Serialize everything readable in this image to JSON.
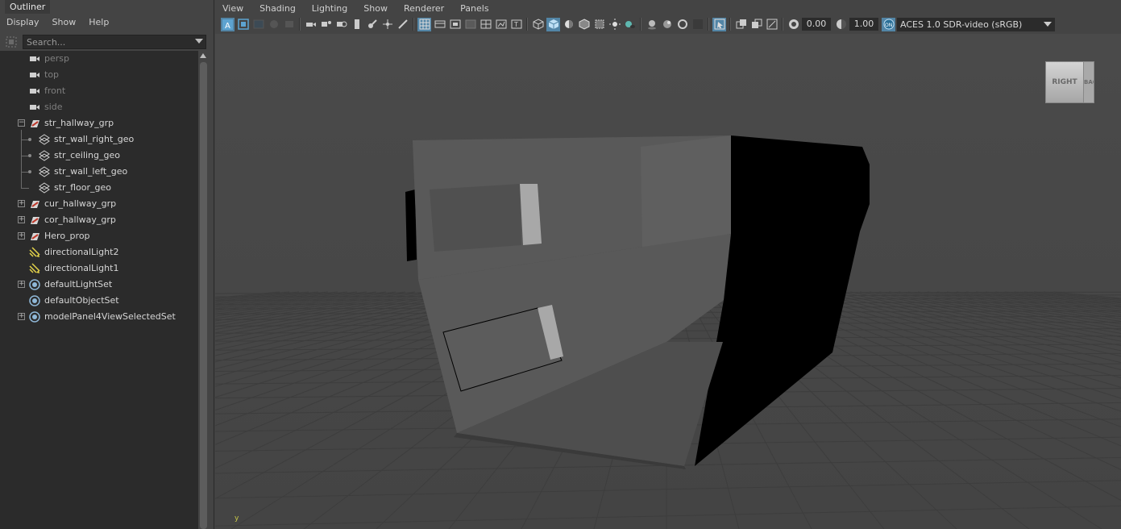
{
  "outliner": {
    "tab_title": "Outliner",
    "menu": [
      "Display",
      "Show",
      "Help"
    ],
    "search_placeholder": "Search...",
    "items": [
      {
        "label": "persp",
        "icon": "camera-icon"
      },
      {
        "label": "top",
        "icon": "camera-icon"
      },
      {
        "label": "front",
        "icon": "camera-icon"
      },
      {
        "label": "side",
        "icon": "camera-icon"
      },
      {
        "label": "str_hallway_grp",
        "icon": "group-icon",
        "expanded": true
      },
      {
        "label": "str_wall_right_geo",
        "icon": "mesh-icon"
      },
      {
        "label": "str_ceiling_geo",
        "icon": "mesh-icon"
      },
      {
        "label": "str_wall_left_geo",
        "icon": "mesh-icon"
      },
      {
        "label": "str_floor_geo",
        "icon": "mesh-icon"
      },
      {
        "label": "cur_hallway_grp",
        "icon": "group-icon",
        "expanded": false
      },
      {
        "label": "cor_hallway_grp",
        "icon": "group-icon",
        "expanded": false
      },
      {
        "label": "Hero_prop",
        "icon": "group-icon",
        "expanded": false
      },
      {
        "label": "directionalLight2",
        "icon": "directional-light-icon"
      },
      {
        "label": "directionalLight1",
        "icon": "directional-light-icon"
      },
      {
        "label": "defaultLightSet",
        "icon": "set-icon",
        "expanded": false
      },
      {
        "label": "defaultObjectSet",
        "icon": "set-icon"
      },
      {
        "label": "modelPanel4ViewSelectedSet",
        "icon": "set-icon",
        "expanded": false
      }
    ]
  },
  "viewport": {
    "menu": [
      "View",
      "Shading",
      "Lighting",
      "Show",
      "Renderer",
      "Panels"
    ],
    "exposure": "0.00",
    "gamma": "1.00",
    "color_space": "ACES 1.0 SDR-video (sRGB)",
    "viewcube_face": "RIGHT",
    "viewcube_side": "BACK",
    "axis_label": "y",
    "colors": {
      "accent": "#5285a6",
      "grid": "#3e3e3e",
      "background": "#4b4b4b"
    }
  }
}
